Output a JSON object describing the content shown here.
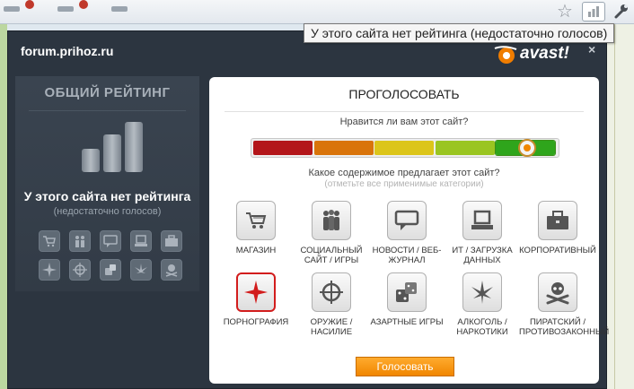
{
  "browser": {
    "tooltip": "У этого сайта нет рейтинга (недостаточно голосов)"
  },
  "popup": {
    "site": "forum.prihoz.ru",
    "brand": "avast!"
  },
  "overall": {
    "title": "ОБЩИЙ РЕЙТИНГ",
    "no_rating": "У этого сайта нет рейтинга",
    "no_rating_sub": "(недостаточно голосов)"
  },
  "vote": {
    "title": "ПРОГОЛОСОВАТЬ",
    "q_like": "Нравится ли вам этот сайт?",
    "q_content": "Какое содержимое предлагает этот сайт?",
    "q_content_hint": "(отметьте все применимые категории)",
    "scale_colors": [
      "#b3161a",
      "#d9740a",
      "#dcc51a",
      "#9ac521",
      "#2fa51c"
    ],
    "scale_selected": 5,
    "categories": [
      {
        "label": "МАГАЗИН",
        "icon": "shopping-cart-icon"
      },
      {
        "label": "СОЦИАЛЬНЫЙ САЙТ / ИГРЫ",
        "icon": "people-icon"
      },
      {
        "label": "НОВОСТИ / ВЕБ-ЖУРНАЛ",
        "icon": "speech-bubble-icon"
      },
      {
        "label": "ИТ / ЗАГРУЗКА ДАННЫХ",
        "icon": "laptop-icon"
      },
      {
        "label": "КОРПОРАТИВНЫЙ",
        "icon": "briefcase-icon"
      },
      {
        "label": "ПОРНОГРАФИЯ",
        "icon": "star-icon",
        "selected": true
      },
      {
        "label": "ОРУЖИЕ / НАСИЛИЕ",
        "icon": "crosshair-icon"
      },
      {
        "label": "АЗАРТНЫЕ ИГРЫ",
        "icon": "dice-icon"
      },
      {
        "label": "АЛКОГОЛЬ / НАРКОТИКИ",
        "icon": "leaf-icon"
      },
      {
        "label": "ПИРАТСКИЙ / ПРОТИВОЗАКОННЫЙ",
        "icon": "skull-icon"
      }
    ],
    "submit": "Голосовать"
  }
}
